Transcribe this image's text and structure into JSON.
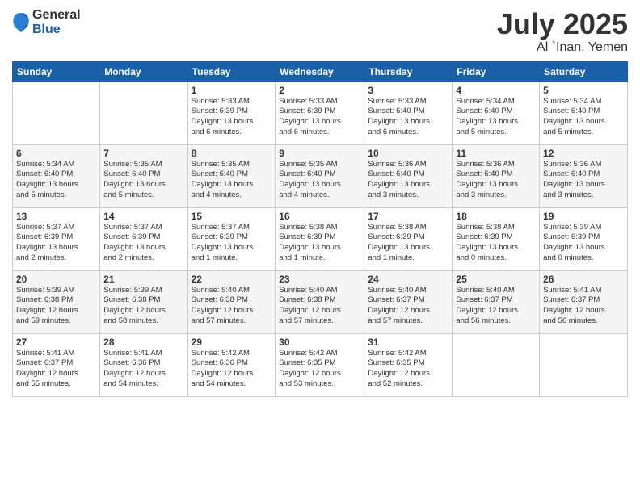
{
  "logo": {
    "general": "General",
    "blue": "Blue"
  },
  "header": {
    "month": "July 2025",
    "location": "Al `Inan, Yemen"
  },
  "weekdays": [
    "Sunday",
    "Monday",
    "Tuesday",
    "Wednesday",
    "Thursday",
    "Friday",
    "Saturday"
  ],
  "weeks": [
    [
      {
        "day": "",
        "info": ""
      },
      {
        "day": "",
        "info": ""
      },
      {
        "day": "1",
        "info": "Sunrise: 5:33 AM\nSunset: 6:39 PM\nDaylight: 13 hours\nand 6 minutes."
      },
      {
        "day": "2",
        "info": "Sunrise: 5:33 AM\nSunset: 6:39 PM\nDaylight: 13 hours\nand 6 minutes."
      },
      {
        "day": "3",
        "info": "Sunrise: 5:33 AM\nSunset: 6:40 PM\nDaylight: 13 hours\nand 6 minutes."
      },
      {
        "day": "4",
        "info": "Sunrise: 5:34 AM\nSunset: 6:40 PM\nDaylight: 13 hours\nand 5 minutes."
      },
      {
        "day": "5",
        "info": "Sunrise: 5:34 AM\nSunset: 6:40 PM\nDaylight: 13 hours\nand 5 minutes."
      }
    ],
    [
      {
        "day": "6",
        "info": "Sunrise: 5:34 AM\nSunset: 6:40 PM\nDaylight: 13 hours\nand 5 minutes."
      },
      {
        "day": "7",
        "info": "Sunrise: 5:35 AM\nSunset: 6:40 PM\nDaylight: 13 hours\nand 5 minutes."
      },
      {
        "day": "8",
        "info": "Sunrise: 5:35 AM\nSunset: 6:40 PM\nDaylight: 13 hours\nand 4 minutes."
      },
      {
        "day": "9",
        "info": "Sunrise: 5:35 AM\nSunset: 6:40 PM\nDaylight: 13 hours\nand 4 minutes."
      },
      {
        "day": "10",
        "info": "Sunrise: 5:36 AM\nSunset: 6:40 PM\nDaylight: 13 hours\nand 3 minutes."
      },
      {
        "day": "11",
        "info": "Sunrise: 5:36 AM\nSunset: 6:40 PM\nDaylight: 13 hours\nand 3 minutes."
      },
      {
        "day": "12",
        "info": "Sunrise: 5:36 AM\nSunset: 6:40 PM\nDaylight: 13 hours\nand 3 minutes."
      }
    ],
    [
      {
        "day": "13",
        "info": "Sunrise: 5:37 AM\nSunset: 6:39 PM\nDaylight: 13 hours\nand 2 minutes."
      },
      {
        "day": "14",
        "info": "Sunrise: 5:37 AM\nSunset: 6:39 PM\nDaylight: 13 hours\nand 2 minutes."
      },
      {
        "day": "15",
        "info": "Sunrise: 5:37 AM\nSunset: 6:39 PM\nDaylight: 13 hours\nand 1 minute."
      },
      {
        "day": "16",
        "info": "Sunrise: 5:38 AM\nSunset: 6:39 PM\nDaylight: 13 hours\nand 1 minute."
      },
      {
        "day": "17",
        "info": "Sunrise: 5:38 AM\nSunset: 6:39 PM\nDaylight: 13 hours\nand 1 minute."
      },
      {
        "day": "18",
        "info": "Sunrise: 5:38 AM\nSunset: 6:39 PM\nDaylight: 13 hours\nand 0 minutes."
      },
      {
        "day": "19",
        "info": "Sunrise: 5:39 AM\nSunset: 6:39 PM\nDaylight: 13 hours\nand 0 minutes."
      }
    ],
    [
      {
        "day": "20",
        "info": "Sunrise: 5:39 AM\nSunset: 6:38 PM\nDaylight: 12 hours\nand 59 minutes."
      },
      {
        "day": "21",
        "info": "Sunrise: 5:39 AM\nSunset: 6:38 PM\nDaylight: 12 hours\nand 58 minutes."
      },
      {
        "day": "22",
        "info": "Sunrise: 5:40 AM\nSunset: 6:38 PM\nDaylight: 12 hours\nand 57 minutes."
      },
      {
        "day": "23",
        "info": "Sunrise: 5:40 AM\nSunset: 6:38 PM\nDaylight: 12 hours\nand 57 minutes."
      },
      {
        "day": "24",
        "info": "Sunrise: 5:40 AM\nSunset: 6:37 PM\nDaylight: 12 hours\nand 57 minutes."
      },
      {
        "day": "25",
        "info": "Sunrise: 5:40 AM\nSunset: 6:37 PM\nDaylight: 12 hours\nand 56 minutes."
      },
      {
        "day": "26",
        "info": "Sunrise: 5:41 AM\nSunset: 6:37 PM\nDaylight: 12 hours\nand 56 minutes."
      }
    ],
    [
      {
        "day": "27",
        "info": "Sunrise: 5:41 AM\nSunset: 6:37 PM\nDaylight: 12 hours\nand 55 minutes."
      },
      {
        "day": "28",
        "info": "Sunrise: 5:41 AM\nSunset: 6:36 PM\nDaylight: 12 hours\nand 54 minutes."
      },
      {
        "day": "29",
        "info": "Sunrise: 5:42 AM\nSunset: 6:36 PM\nDaylight: 12 hours\nand 54 minutes."
      },
      {
        "day": "30",
        "info": "Sunrise: 5:42 AM\nSunset: 6:35 PM\nDaylight: 12 hours\nand 53 minutes."
      },
      {
        "day": "31",
        "info": "Sunrise: 5:42 AM\nSunset: 6:35 PM\nDaylight: 12 hours\nand 52 minutes."
      },
      {
        "day": "",
        "info": ""
      },
      {
        "day": "",
        "info": ""
      }
    ]
  ]
}
